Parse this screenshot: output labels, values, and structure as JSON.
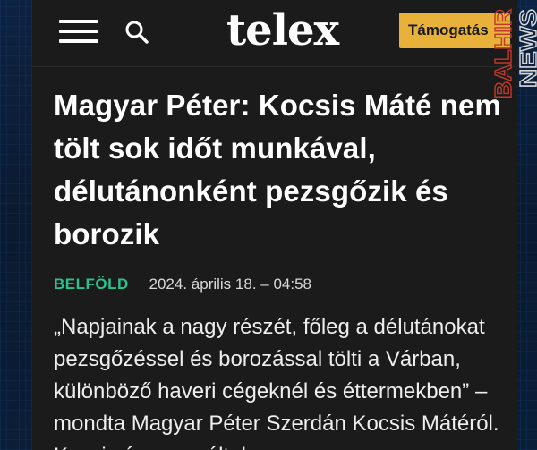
{
  "header": {
    "menu_icon": "hamburger-menu-icon",
    "search_icon": "search-icon",
    "logo_text": "telex",
    "support_label": "Támogatás"
  },
  "watermark": {
    "line1": "BALHIR",
    "line2": "NEWS",
    "colors": {
      "balhir": "#c0392b",
      "news": "#d8d8d8"
    }
  },
  "article": {
    "headline": "Magyar Péter: Kocsis Máté nem tölt sok időt munkával, délutánonként pezsgőzik és borozik",
    "category": "BELFÖLD",
    "date": "2024. április 18. – 04:58",
    "lead": "„Napjainak a nagy részét, főleg a délutánokat pezsgőzéssel és borozással tölti a Várban, különböző haveri cégeknél és éttermekben” – mondta Magyar Péter Szerdán Kocsis Mátéról. Kocsis úgy reagált, hogy"
  },
  "colors": {
    "background": "#1b1b1b",
    "accent_support": "#e8b23a",
    "category": "#29c28b",
    "text": "#ffffff"
  }
}
